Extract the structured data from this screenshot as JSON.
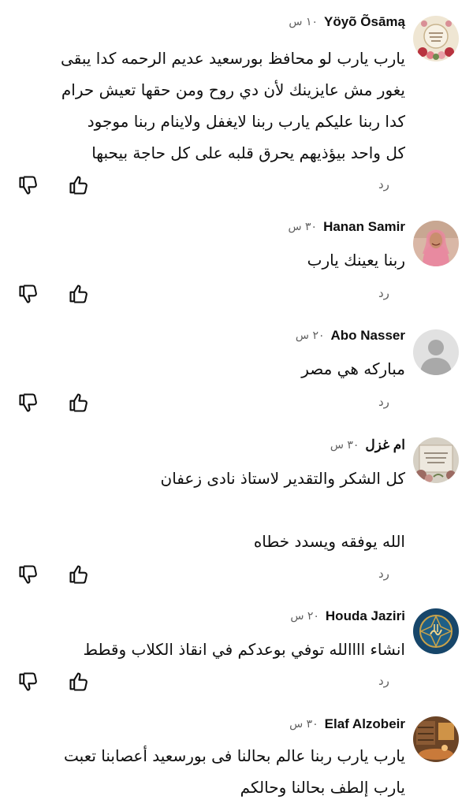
{
  "comments": [
    {
      "author": "Yöyõ Õsāmą",
      "time": "١٠ س",
      "lines": [
        "يارب يارب لو محافظ بورسعيد عديم الرحمه كدا يبقى",
        "يغور مش عايزينك لأن دي روح ومن حقها تعيش حرام",
        "كدا ربنا عليكم يارب ربنا لايغفل ولاينام ربنا موجود",
        "كل واحد بيؤذيهم يحرق قلبه على كل حاجة بيحبها"
      ],
      "reply": "رد",
      "avatar": {
        "icon": "floral-frame-avatar-icon",
        "bg": "#efe6d3",
        "accent": "#b8333f"
      }
    },
    {
      "author": "Hanan Samir",
      "time": "٣٠ س",
      "lines": [
        "ربنا يعينك يارب"
      ],
      "reply": "رد",
      "avatar": {
        "icon": "woman-pink-scarf-avatar-icon",
        "bg": "#d9b7a6",
        "accent": "#e88aa0"
      }
    },
    {
      "author": "Abo Nasser",
      "time": "٢٠ س",
      "lines": [
        "مباركه هي مصر"
      ],
      "reply": "رد",
      "avatar": {
        "icon": "default-person-avatar-icon",
        "bg": "#e1e1e1",
        "accent": "#a9a9a9"
      }
    },
    {
      "author": "ام غزل",
      "time": "٣٠ س",
      "lines": [
        "كل الشكر والتقدير لاستاذ نادى زعفان",
        "",
        "الله يوفقه ويسدد خطاه"
      ],
      "reply": "رد",
      "avatar": {
        "icon": "rose-frame-avatar-icon",
        "bg": "#d6d0c4",
        "accent": "#9c6b63"
      }
    },
    {
      "author": "Houda Jaziri",
      "time": "٢٠ س",
      "lines": [
        "انشاء اااالله توفي بوعدكم في انقاذ الكلاب وقطط"
      ],
      "reply": "رد",
      "avatar": {
        "icon": "calligraphy-emblem-avatar-icon",
        "bg": "#17466a",
        "accent": "#c9a24a"
      }
    },
    {
      "author": "Elaf Alzobeir",
      "time": "٣٠ س",
      "lines": [
        "يارب يارب ربنا عالم بحالنا فى بورسعيد أعصابنا تعبت",
        "يارب إلطف بحالنا وحالكم"
      ],
      "reply": "رد",
      "avatar": {
        "icon": "cozy-room-avatar-icon",
        "bg": "#6b4426",
        "accent": "#e0a14d"
      }
    }
  ]
}
